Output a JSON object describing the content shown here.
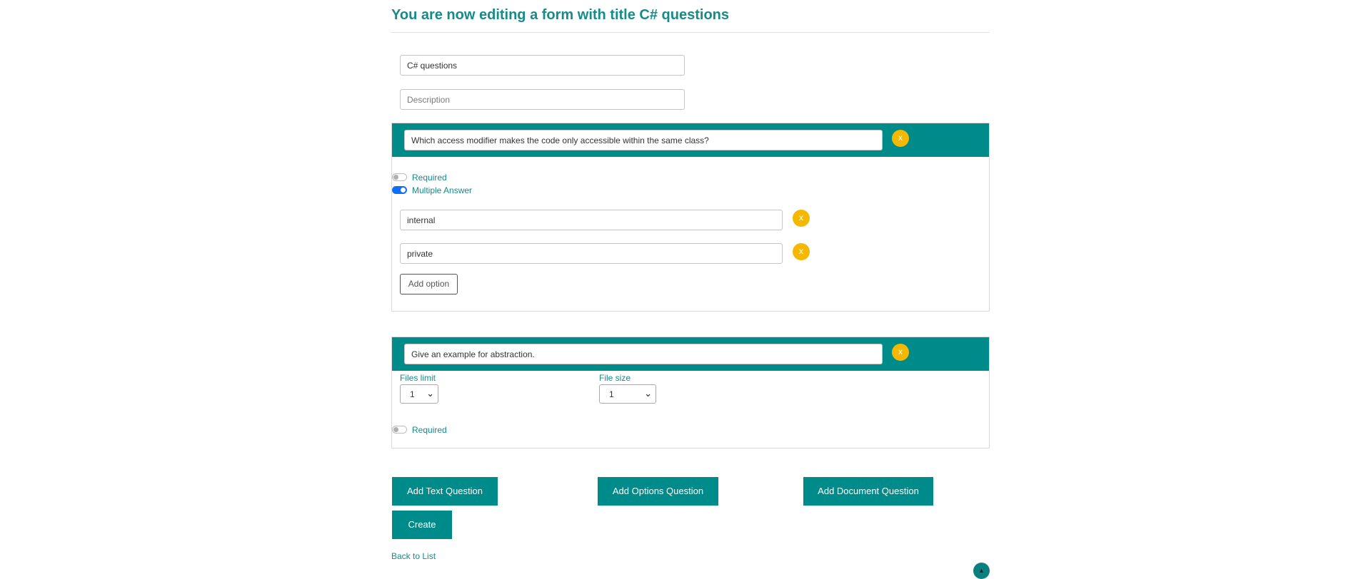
{
  "page": {
    "title": "You are now editing a form with title C# questions"
  },
  "form": {
    "title_value": "C# questions",
    "description_placeholder": "Description"
  },
  "questions": [
    {
      "text": "Which access modifier makes the code only accessible within the same class?",
      "remove_label": "x",
      "required_label": "Required",
      "required_on": false,
      "multiple_answer_label": "Multiple Answer",
      "multiple_answer_on": true,
      "options": [
        {
          "value": "internal",
          "remove_label": "x"
        },
        {
          "value": "private",
          "remove_label": "x"
        }
      ],
      "add_option_label": "Add option"
    },
    {
      "text": "Give an example for abstraction.",
      "remove_label": "x",
      "files_limit_label": "Files limit",
      "files_limit_value": "1",
      "file_size_label": "File size",
      "file_size_value": "1",
      "required_label": "Required",
      "required_on": false
    }
  ],
  "actions": {
    "add_text_question": "Add Text Question",
    "add_options_question": "Add Options Question",
    "add_document_question": "Add Document Question",
    "create": "Create",
    "back_to_list": "Back to List"
  },
  "icons": {
    "chevron": "chevron-down-icon",
    "scroll_top": "arrow-up-icon"
  },
  "colors": {
    "accent": "#008b8b",
    "remove_button": "#f5b800",
    "toggle_on": "#0d6efd",
    "label_text": "#178a8a"
  }
}
